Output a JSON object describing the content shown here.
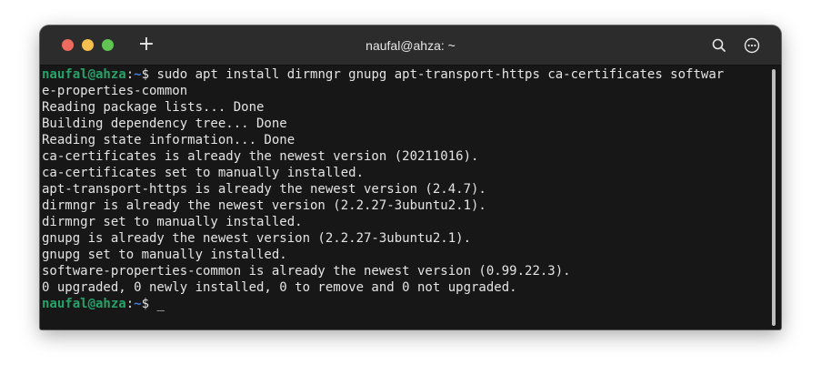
{
  "window": {
    "title": "naufal@ahza: ~",
    "buttons": {
      "close_color": "#ed6a5e",
      "minimize_color": "#f5bf4f",
      "maximize_color": "#61c554"
    },
    "new_tab_label": "+",
    "toolbar_icons": [
      "search-icon",
      "kebab-menu-icon"
    ]
  },
  "terminal": {
    "prompt1": {
      "user": "naufal@ahza",
      "sep": ":",
      "path": "~",
      "symbol": "$ ",
      "command": "sudo apt install dirmngr gnupg apt-transport-https ca-certificates softwar"
    },
    "command_wrap": "e-properties-common",
    "output": [
      "Reading package lists... Done",
      "Building dependency tree... Done",
      "Reading state information... Done",
      "ca-certificates is already the newest version (20211016).",
      "ca-certificates set to manually installed.",
      "apt-transport-https is already the newest version (2.4.7).",
      "dirmngr is already the newest version (2.2.27-3ubuntu2.1).",
      "dirmngr set to manually installed.",
      "gnupg is already the newest version (2.2.27-3ubuntu2.1).",
      "gnupg set to manually installed.",
      "software-properties-common is already the newest version (0.99.22.3).",
      "0 upgraded, 0 newly installed, 0 to remove and 0 not upgraded."
    ],
    "prompt2": {
      "user": "naufal@ahza",
      "sep": ":",
      "path": "~",
      "symbol": "$ ",
      "cursor": "_"
    },
    "colors": {
      "background": "#171717",
      "foreground": "#e4e4e4",
      "user": "#26a269",
      "path": "#4a7bd0"
    }
  }
}
